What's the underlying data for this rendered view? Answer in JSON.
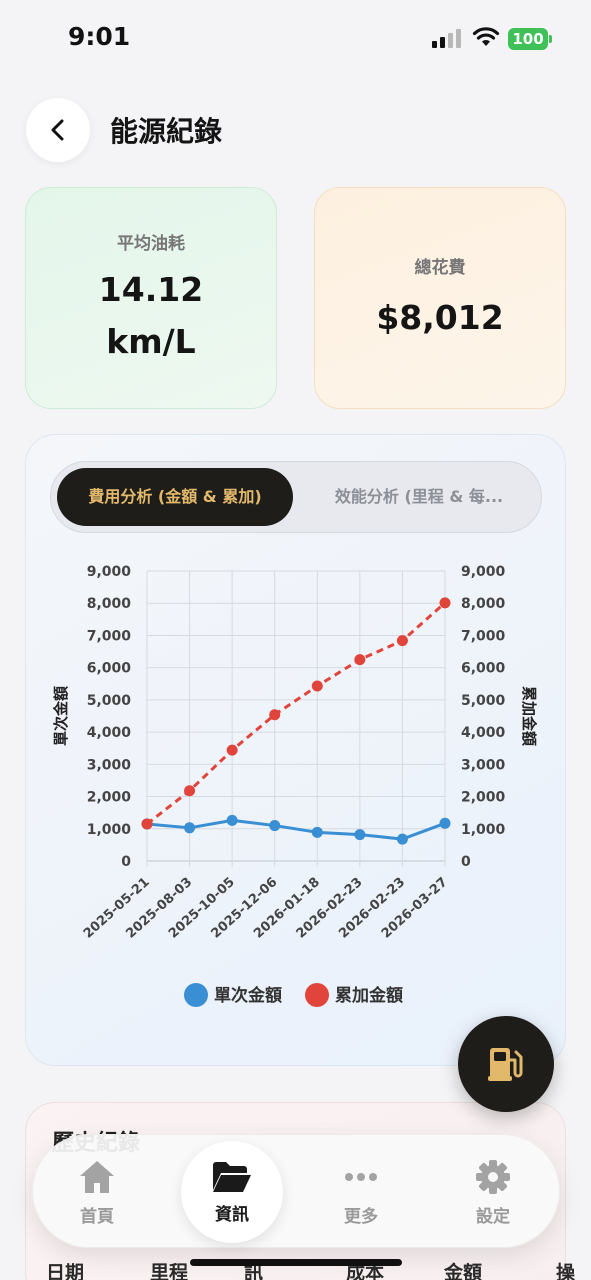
{
  "status_bar": {
    "time": "9:01",
    "battery": "100"
  },
  "header": {
    "title": "能源紀錄"
  },
  "stats": {
    "avg_label": "平均油耗",
    "avg_value": "14.12",
    "avg_unit": "km/L",
    "total_label": "總花費",
    "total_value": "$8,012"
  },
  "tabs": {
    "active": "費用分析 (金額 & 累加)",
    "inactive": "效能分析 (里程 & 每..."
  },
  "colors": {
    "single": "#3a8fd4",
    "cumulative": "#e0443a",
    "accent": "#e2b96b",
    "dark": "#1f1d1a"
  },
  "chart_data": {
    "type": "line",
    "categories": [
      "2025-05-21",
      "2025-08-03",
      "2025-10-05",
      "2025-12-06",
      "2026-01-18",
      "2026-02-23",
      "2026-02-23",
      "2026-03-27"
    ],
    "series": [
      {
        "name": "單次金額",
        "axis": "left",
        "style": "solid",
        "values": [
          1150,
          1030,
          1260,
          1100,
          890,
          820,
          680,
          1170
        ]
      },
      {
        "name": "累加金額",
        "axis": "right",
        "style": "dashed",
        "values": [
          1150,
          2180,
          3440,
          4540,
          5430,
          6250,
          6840,
          8012
        ]
      }
    ],
    "ylabel": "單次金額",
    "y2label": "累加金額",
    "ylim": [
      0,
      9000
    ],
    "y2lim": [
      0,
      9000
    ],
    "yticks": [
      "0",
      "1,000",
      "2,000",
      "3,000",
      "4,000",
      "5,000",
      "6,000",
      "7,000",
      "8,000",
      "9,000"
    ],
    "grid": true,
    "legend": "bottom"
  },
  "records": {
    "title": "歷史紀錄"
  },
  "table": {
    "headers": [
      "日期",
      "里程",
      "訊",
      "成本",
      "金額",
      "操"
    ]
  },
  "nav": {
    "home": "首頁",
    "info": "資訊",
    "more": "更多",
    "settings": "設定"
  }
}
